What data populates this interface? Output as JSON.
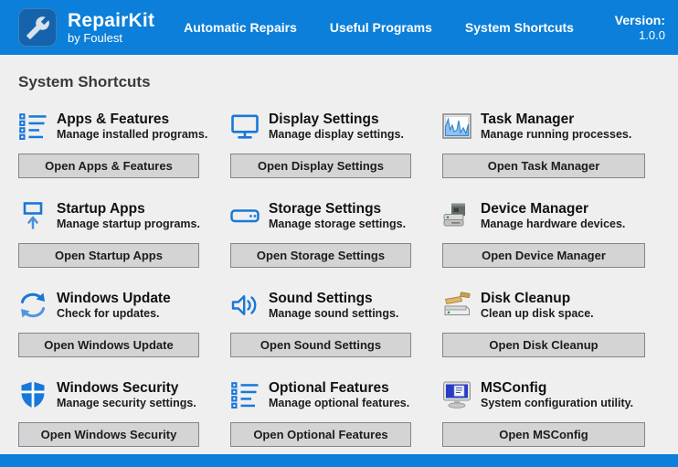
{
  "header": {
    "brand": {
      "name": "RepairKit",
      "byline": "by Foulest",
      "logo_icon": "wrench-icon"
    },
    "nav": [
      "Automatic Repairs",
      "Useful Programs",
      "System Shortcuts"
    ],
    "version_label": "Version:",
    "version_value": "1.0.0"
  },
  "page": {
    "title": "System Shortcuts"
  },
  "shortcuts": [
    {
      "title": "Apps & Features",
      "description": "Manage installed programs.",
      "button_label": "Open Apps & Features",
      "icon": "list-icon"
    },
    {
      "title": "Display Settings",
      "description": "Manage display settings.",
      "button_label": "Open Display Settings",
      "icon": "monitor-icon"
    },
    {
      "title": "Task Manager",
      "description": "Manage running processes.",
      "button_label": "Open Task Manager",
      "icon": "performance-graph-icon"
    },
    {
      "title": "Startup Apps",
      "description": "Manage startup programs.",
      "button_label": "Open Startup Apps",
      "icon": "startup-arrow-icon"
    },
    {
      "title": "Storage Settings",
      "description": "Manage storage settings.",
      "button_label": "Open Storage Settings",
      "icon": "drive-icon"
    },
    {
      "title": "Device Manager",
      "description": "Manage hardware devices.",
      "button_label": "Open Device Manager",
      "icon": "hardware-icon"
    },
    {
      "title": "Windows Update",
      "description": "Check for updates.",
      "button_label": "Open Windows Update",
      "icon": "sync-icon"
    },
    {
      "title": "Sound Settings",
      "description": "Manage sound settings.",
      "button_label": "Open Sound Settings",
      "icon": "speaker-icon"
    },
    {
      "title": "Disk Cleanup",
      "description": "Clean up disk space.",
      "button_label": "Open Disk Cleanup",
      "icon": "disk-brush-icon"
    },
    {
      "title": "Windows Security",
      "description": "Manage security settings.",
      "button_label": "Open Windows Security",
      "icon": "shield-icon"
    },
    {
      "title": "Optional Features",
      "description": "Manage optional features.",
      "button_label": "Open Optional Features",
      "icon": "list-icon"
    },
    {
      "title": "MSConfig",
      "description": "System configuration utility.",
      "button_label": "Open MSConfig",
      "icon": "msconfig-monitor-icon"
    }
  ],
  "colors": {
    "header_blue": "#0b7fd9",
    "logo_badge_blue": "#1563ad",
    "accent_icon_blue": "#1878d8",
    "page_background": "#efefef",
    "button_background": "#d4d4d4",
    "button_border": "#7b8793"
  }
}
